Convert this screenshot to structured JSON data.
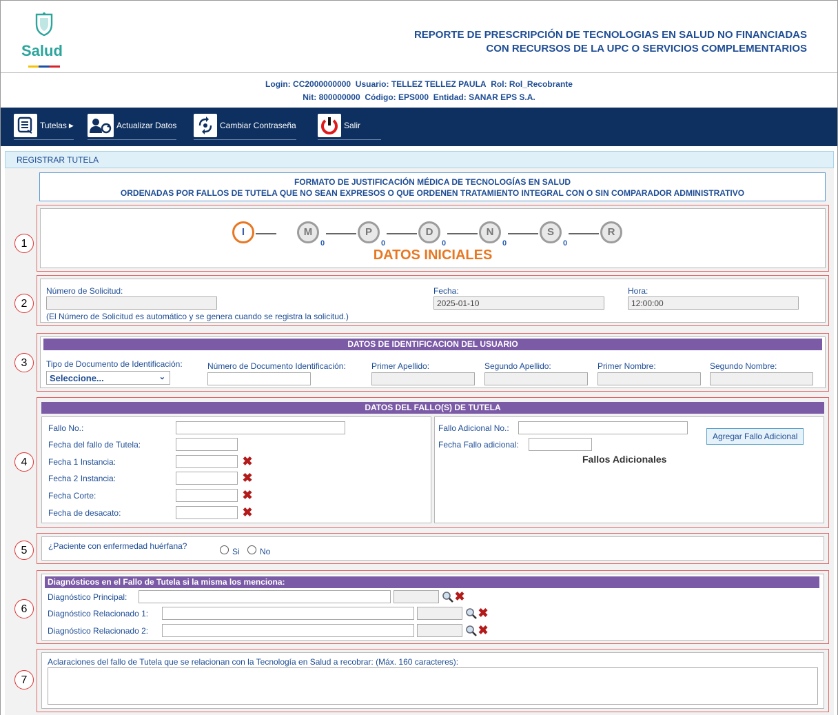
{
  "header": {
    "logo_text": "Salud",
    "title_line1": "REPORTE DE PRESCRIPCIÓN DE TECNOLOGIAS EN SALUD NO FINANCIADAS",
    "title_line2": "CON RECURSOS DE LA UPC O SERVICIOS COMPLEMENTARIOS"
  },
  "session": {
    "login_label": "Login:",
    "login": "CC2000000000",
    "usuario_label": "Usuario:",
    "usuario": "TELLEZ TELLEZ PAULA",
    "rol_label": "Rol:",
    "rol": "Rol_Recobrante",
    "nit_label": "Nit:",
    "nit": "800000000",
    "codigo_label": "Código:",
    "codigo": "EPS000",
    "entidad_label": "Entidad:",
    "entidad": "SANAR EPS S.A."
  },
  "nav": {
    "tutelas": "Tutelas",
    "actualizar": "Actualizar Datos",
    "cambiar": "Cambiar Contraseña",
    "salir": "Salir"
  },
  "breadcrumb": "REGISTRAR TUTELA",
  "format_title": {
    "line1": "FORMATO DE JUSTIFICACIÓN MÉDICA DE TECNOLOGÍAS EN SALUD",
    "line2": "ORDENADAS POR FALLOS DE TUTELA QUE NO SEAN EXPRESOS O QUE ORDENEN TRATAMIENTO INTEGRAL CON O SIN COMPARADOR ADMINISTRATIVO"
  },
  "section_numbers": [
    "1",
    "2",
    "3",
    "4",
    "5",
    "6",
    "7"
  ],
  "steps": {
    "items": [
      "I",
      "M",
      "P",
      "D",
      "N",
      "S",
      "R"
    ],
    "counts": [
      "0",
      "0",
      "0",
      "0",
      "0"
    ],
    "current_label": "DATOS INICIALES"
  },
  "solicitud": {
    "numero_label": "Número de Solicitud:",
    "numero_value": "",
    "numero_note": "(El Número de Solicitud es automático y se genera cuando se registra la solicitud.)",
    "fecha_label": "Fecha:",
    "fecha_value": "2025-01-10",
    "hora_label": "Hora:",
    "hora_value": "12:00:00"
  },
  "usuario": {
    "header": "DATOS DE IDENTIFICACION DEL USUARIO",
    "tipo_doc_label": "Tipo de Documento de Identificación:",
    "tipo_doc_value": "Seleccione...",
    "num_doc_label": "Número de Documento Identificación:",
    "primer_apellido_label": "Primer Apellido:",
    "segundo_apellido_label": "Segundo Apellido:",
    "primer_nombre_label": "Primer Nombre:",
    "segundo_nombre_label": "Segundo Nombre:"
  },
  "fallo": {
    "header": "DATOS DEL FALLO(S) DE TUTELA",
    "fallo_no_label": "Fallo No.:",
    "fecha_fallo_label": "Fecha del fallo de Tutela:",
    "fecha_1_label": "Fecha 1 Instancia:",
    "fecha_2_label": "Fecha 2 Instancia:",
    "fecha_corte_label": "Fecha Corte:",
    "fecha_desacato_label": "Fecha de desacato:",
    "adicional_no_label": "Fallo Adicional No.:",
    "fecha_adicional_label": "Fecha Fallo adicional:",
    "agregar_button": "Agregar Fallo Adicional",
    "adicionales_title": "Fallos Adicionales"
  },
  "huerfana": {
    "question": "¿Paciente con enfermedad huérfana?",
    "si": "Si",
    "no": "No"
  },
  "diagnosticos": {
    "header": "Diagnósticos en el Fallo de Tutela si la misma los menciona:",
    "principal_label": "Diagnóstico Principal:",
    "rel1_label": "Diagnóstico Relacionado 1:",
    "rel2_label": "Diagnóstico Relacionado 2:"
  },
  "aclaraciones": {
    "label": "Aclaraciones del fallo de Tutela que se relacionan con la Tecnología en Salud a recobrar: (Máx. 160 caracteres):"
  },
  "colors": {
    "nav_bg": "#0e3060",
    "accent_orange": "#e87722",
    "purple_header": "#7b5aa6",
    "text_blue": "#1e4d94",
    "delete_red": "#b31b1b"
  }
}
